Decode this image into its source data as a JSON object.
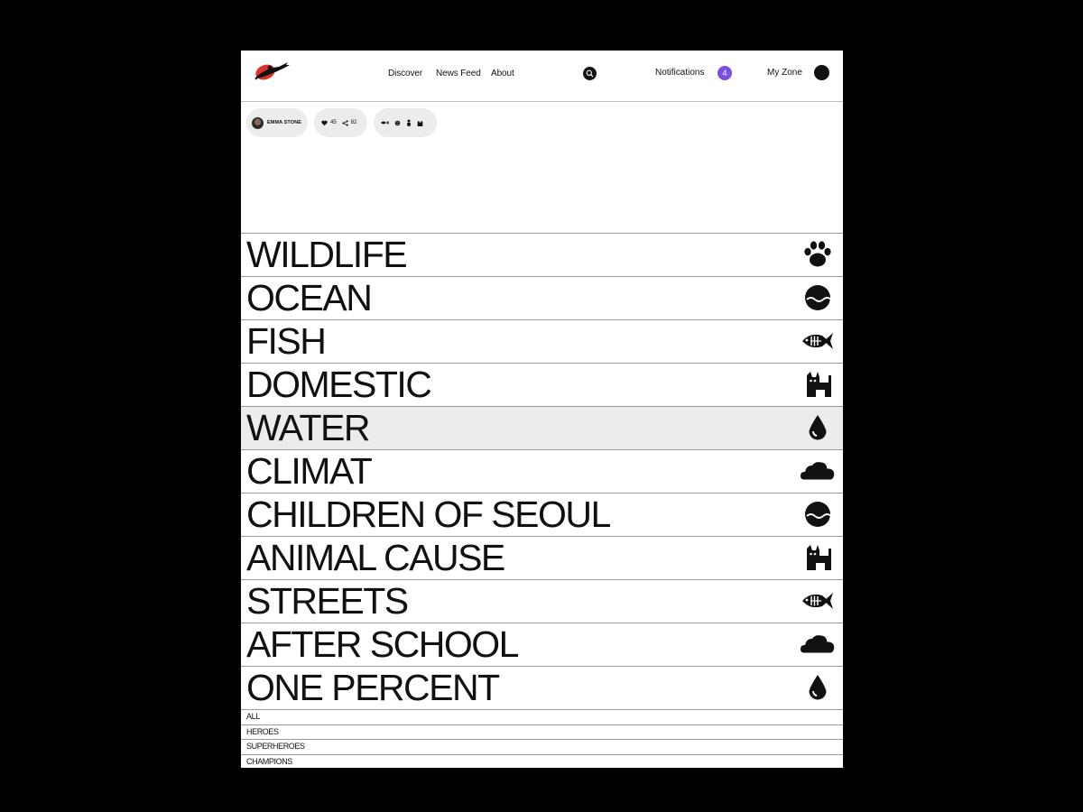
{
  "nav": {
    "links": [
      "Discover",
      "News Feed",
      "About"
    ],
    "notifications_label": "Notifications",
    "notifications_count": "4",
    "my_zone_label": "My Zone",
    "badge_color": "#7b4fe0",
    "logo_icon": "hero-logo-icon",
    "search_icon": "search-icon"
  },
  "post": {
    "author": "EMMA STONE",
    "likes": "45",
    "shares": "82",
    "category_icons": [
      "fish-icon",
      "brain-icon",
      "figure-icon",
      "cat-icon"
    ]
  },
  "categories": [
    {
      "label": "WILDLIFE",
      "icon": "paw-icon",
      "active": false
    },
    {
      "label": "OCEAN",
      "icon": "ocean-icon",
      "active": false
    },
    {
      "label": "FISH",
      "icon": "fish-icon",
      "active": false
    },
    {
      "label": "DOMESTIC",
      "icon": "cat-icon",
      "active": false
    },
    {
      "label": "WATER",
      "icon": "drop-icon",
      "active": true
    },
    {
      "label": "CLIMAT",
      "icon": "cloud-icon",
      "active": false
    },
    {
      "label": "CHILDREN OF SEOUL",
      "icon": "ocean-icon",
      "active": false
    },
    {
      "label": "ANIMAL CAUSE",
      "icon": "cat-icon",
      "active": false
    },
    {
      "label": "STREETS",
      "icon": "fish-icon",
      "active": false
    },
    {
      "label": "AFTER SCHOOL",
      "icon": "cloud-icon",
      "active": false
    },
    {
      "label": "ONE PERCENT",
      "icon": "drop-icon",
      "active": false
    }
  ],
  "filters": [
    "ALL",
    "HEROES",
    "SUPERHEROES",
    "CHAMPIONS"
  ]
}
